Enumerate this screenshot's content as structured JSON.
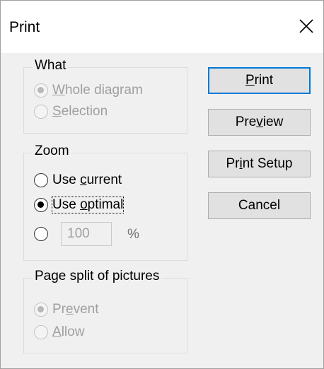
{
  "window": {
    "title": "Print",
    "close_symbol": "×"
  },
  "what_group": {
    "label": "What",
    "options": [
      {
        "label_before": "",
        "mnemonic": "W",
        "label_after": "hole diagram",
        "checked": true,
        "enabled": false
      },
      {
        "label_before": "",
        "mnemonic": "S",
        "label_after": "election",
        "checked": false,
        "enabled": false
      }
    ]
  },
  "zoom_group": {
    "label": "Zoom",
    "options": [
      {
        "label_before": "Use ",
        "mnemonic": "c",
        "label_after": "urrent",
        "checked": false,
        "enabled": true
      },
      {
        "label_before": "Use ",
        "mnemonic": "o",
        "label_after": "ptimal",
        "checked": true,
        "enabled": true,
        "focused": true
      },
      {
        "checked": false,
        "enabled": true
      }
    ],
    "custom_value": "100",
    "custom_unit": "%"
  },
  "split_group": {
    "label": "Page split of pictures",
    "options": [
      {
        "label_before": "Pr",
        "mnemonic": "e",
        "label_after": "vent",
        "checked": true,
        "enabled": false
      },
      {
        "label_before": "",
        "mnemonic": "A",
        "label_after": "llow",
        "checked": false,
        "enabled": false
      }
    ]
  },
  "buttons": {
    "print": {
      "before": "",
      "mnemonic": "P",
      "after": "rint",
      "is_default": true
    },
    "preview": {
      "before": "Pre",
      "mnemonic": "v",
      "after": "iew"
    },
    "print_setup": {
      "before": "Pr",
      "mnemonic": "i",
      "after": "nt Setup"
    },
    "cancel": {
      "label": "Cancel"
    }
  },
  "colors": {
    "dialog_bg": "#f0f0f0",
    "title_bg": "#ffffff",
    "default_button_border": "#0078d7",
    "disabled_text": "#a0a0a0"
  },
  "icons": {
    "close": "close-icon"
  }
}
